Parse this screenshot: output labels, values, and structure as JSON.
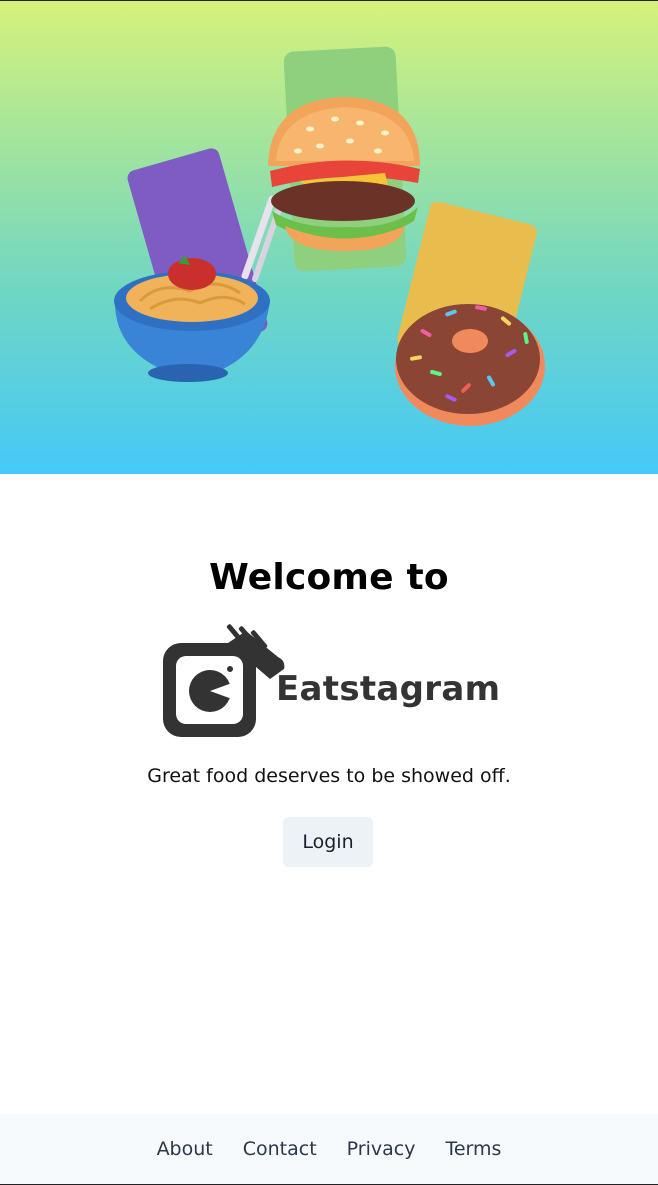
{
  "hero": {
    "illustration_items": [
      "spaghetti-bowl-icon",
      "burger-icon",
      "donut-icon"
    ],
    "gradient_colors": [
      "#d6f27a",
      "#45c9f8"
    ]
  },
  "welcome": {
    "heading": "Welcome to",
    "brand_name": "Eatstagram",
    "tagline": "Great food deserves to be showed off."
  },
  "actions": {
    "login_label": "Login"
  },
  "footer": {
    "links": [
      {
        "label": "About"
      },
      {
        "label": "Contact"
      },
      {
        "label": "Privacy"
      },
      {
        "label": "Terms"
      }
    ]
  },
  "colors": {
    "button_bg": "#edf2f7",
    "footer_bg": "#f7fafc",
    "logo_dark": "#333333"
  }
}
